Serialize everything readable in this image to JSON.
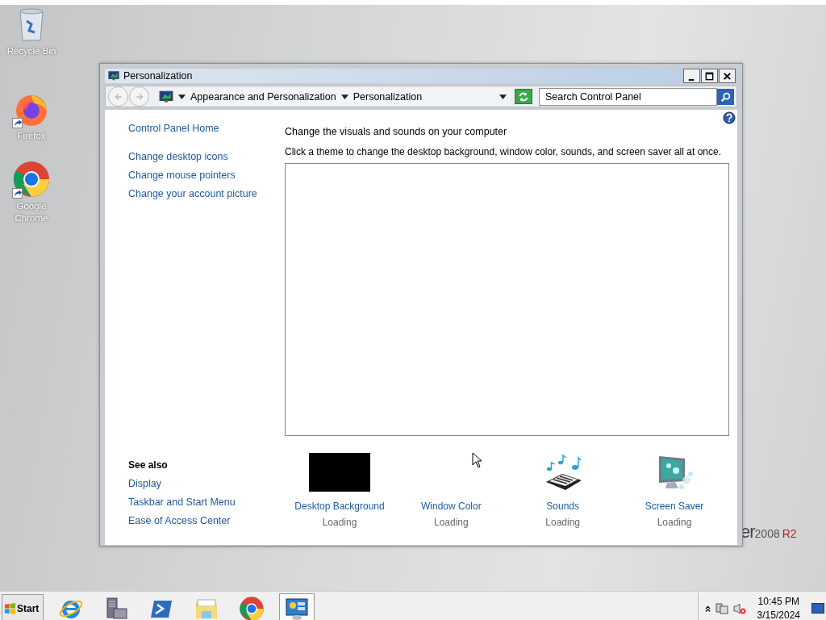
{
  "desktop_icons": [
    {
      "kind": "recycle",
      "label": "Recycle Bin"
    },
    {
      "kind": "firefox",
      "label": "Firefox"
    },
    {
      "kind": "chrome",
      "label": "Google\nChrome"
    }
  ],
  "wallpaper_logo": {
    "text": "er",
    "version": "2008",
    "edition": "R2"
  },
  "window": {
    "title": "Personalization",
    "address": {
      "segments": [
        "Appearance and Personalization",
        "Personalization"
      ]
    },
    "search": {
      "placeholder": "Search Control Panel"
    },
    "sidebar": {
      "home": "Control Panel Home",
      "links": [
        "Change desktop icons",
        "Change mouse pointers",
        "Change your account picture"
      ],
      "see_also": {
        "title": "See also",
        "links": [
          "Display",
          "Taskbar and Start Menu",
          "Ease of Access Center"
        ]
      }
    },
    "heading": "Change the visuals and sounds on your computer",
    "description": "Click a theme to change the desktop background, window color, sounds, and screen saver all at once.",
    "settings": [
      {
        "kind": "background",
        "label": "Desktop Background",
        "status": "Loading"
      },
      {
        "kind": "color",
        "label": "Window Color",
        "status": "Loading"
      },
      {
        "kind": "sounds",
        "label": "Sounds",
        "status": "Loading"
      },
      {
        "kind": "saver",
        "label": "Screen Saver",
        "status": "Loading"
      }
    ]
  },
  "taskbar": {
    "start": "Start",
    "apps": [
      {
        "kind": "ie",
        "selected": false
      },
      {
        "kind": "server",
        "selected": false
      },
      {
        "kind": "shell",
        "selected": false
      },
      {
        "kind": "explorer",
        "selected": false
      },
      {
        "kind": "chrome",
        "selected": false
      },
      {
        "kind": "control",
        "selected": true
      }
    ],
    "clock": {
      "time": "10:45 PM",
      "date": "3/15/2024"
    }
  }
}
